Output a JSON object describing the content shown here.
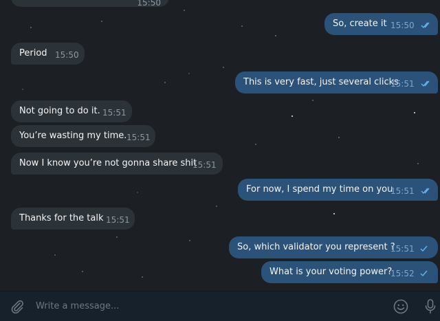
{
  "chat": {
    "top_partial_time": "15:50",
    "messages": [
      {
        "text": "So, create  it",
        "time": "15:50",
        "direction": "out",
        "status": "read"
      },
      {
        "text": "Period",
        "time": "15:50",
        "direction": "in"
      },
      {
        "text": "This is very fast, just several clicks",
        "time": "15:51",
        "direction": "out",
        "status": "read"
      },
      {
        "text": "Not going to do it.",
        "time": "15:51",
        "direction": "in"
      },
      {
        "text": "You’re wasting my time.",
        "time": "15:51",
        "direction": "in"
      },
      {
        "text": "Now I know you’re not gonna share shit",
        "time": "15:51",
        "direction": "in"
      },
      {
        "text": "For now, I spend my time on you",
        "time": "15:51",
        "direction": "out",
        "status": "read"
      },
      {
        "text": "Thanks for the talk",
        "time": "15:51",
        "direction": "in"
      },
      {
        "text": "So, which validator you represent ?",
        "time": "15:51",
        "direction": "out",
        "status": "sent"
      },
      {
        "text": "What is your voting power?",
        "time": "15:52",
        "direction": "out",
        "status": "sent"
      }
    ]
  },
  "composer": {
    "placeholder": "Write a message...",
    "attach_icon": "paperclip-icon",
    "emoji_icon": "smiley-icon",
    "voice_icon": "microphone-icon"
  },
  "colors": {
    "incoming_bubble": "#2b3238",
    "outgoing_bubble": "#2b5278",
    "read_check": "#64b5ef",
    "composer_bg": "#17212b"
  }
}
